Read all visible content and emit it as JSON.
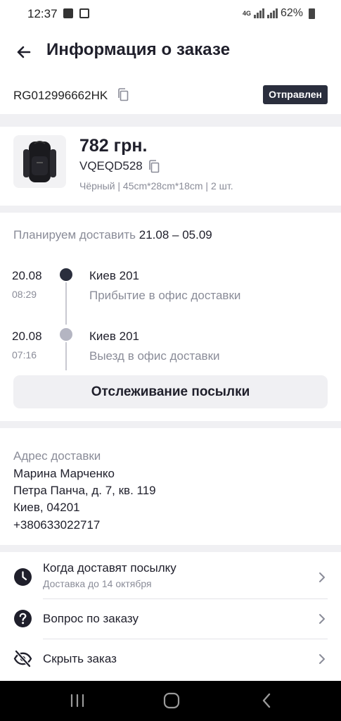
{
  "status_bar": {
    "time": "12:37",
    "network": "4G",
    "battery": "62%"
  },
  "header": {
    "title": "Информация о заказе"
  },
  "order": {
    "tracking_number": "RG012996662HK",
    "status_badge": "Отправлен"
  },
  "product": {
    "price": "782 грн.",
    "sku": "VQEQD528",
    "variant": "Чёрный | 45cm*28cm*18cm | 2 шт."
  },
  "delivery": {
    "plan_label": "Планируем доставить",
    "plan_dates": "21.08 – 05.09",
    "events": [
      {
        "date": "20.08",
        "time": "08:29",
        "city": "Киев 201",
        "description": "Прибытие в офис доставки",
        "active": true
      },
      {
        "date": "20.08",
        "time": "07:16",
        "city": "Киев 201",
        "description": "Выезд в офис доставки",
        "active": false
      }
    ],
    "tracking_button": "Отслеживание посылки"
  },
  "address": {
    "label": "Адрес доставки",
    "name": "Марина Марченко",
    "street": "Петра Панча, д. 7, кв. 119",
    "city": "Киев, 04201",
    "phone": "+380633022717"
  },
  "menu": [
    {
      "icon": "clock-icon",
      "title": "Когда доставят посылку",
      "subtitle": "Доставка до 14 октября"
    },
    {
      "icon": "question-icon",
      "title": "Вопрос по заказу"
    },
    {
      "icon": "eye-off-icon",
      "title": "Скрыть заказ"
    }
  ],
  "colors": {
    "primary_dark": "#2a2e3d",
    "muted_text": "#8a8c98",
    "background": "#f0f0f3",
    "timeline_inactive": "#b4b5c2"
  }
}
